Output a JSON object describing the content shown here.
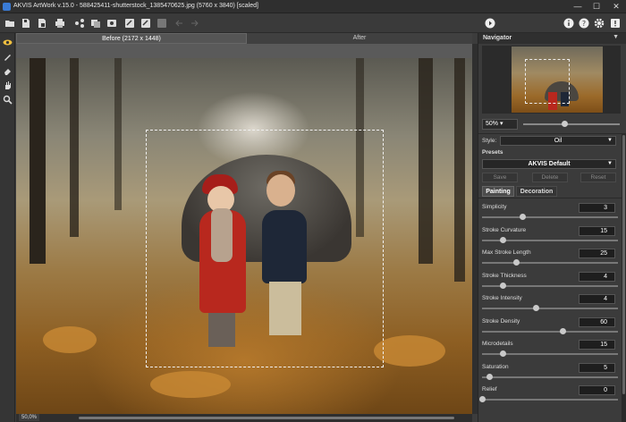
{
  "window": {
    "title": "AKVIS ArtWork v.15.0 - 588425411-shutterstock_1385470625.jpg (5760 x 3840) [scaled]",
    "minimize": "—",
    "maximize": "☐",
    "close": "✕"
  },
  "toolbar": {
    "icons": [
      "open-icon",
      "save-icon",
      "save-as-icon",
      "print-icon",
      "share-icon",
      "batch-icon",
      "preset-icon",
      "settings-icon",
      "undo-icon",
      "redo-icon",
      "forward-icon",
      "back-icon",
      "run-icon",
      "info-icon",
      "help-icon",
      "gear-icon",
      "notification-icon"
    ]
  },
  "left_tools": [
    "eye-icon",
    "brush-icon",
    "eraser-icon",
    "hand-icon",
    "zoom-icon"
  ],
  "view_tabs": {
    "before": "Before (2172 x 1448)",
    "after": "After"
  },
  "status": {
    "zoom": "50,0%"
  },
  "navigator": {
    "header": "Navigator",
    "zoom": "50%",
    "zoom_slider": 0.5
  },
  "settings": {
    "style_label": "Style:",
    "style_value": "Oil",
    "presets_label": "Presets",
    "preset_value": "AKVIS Default",
    "save": "Save",
    "delete": "Delete",
    "reset": "Reset",
    "tab_painting": "Painting",
    "tab_decoration": "Decoration",
    "params": [
      {
        "label": "Simplicity",
        "value": "3",
        "fraction": 0.3
      },
      {
        "label": "Stroke Curvature",
        "value": "15",
        "fraction": 0.15
      },
      {
        "label": "Max Stroke Length",
        "value": "25",
        "fraction": 0.25
      },
      {
        "label": "Stroke Thickness",
        "value": "4",
        "fraction": 0.15
      },
      {
        "label": "Stroke Intensity",
        "value": "4",
        "fraction": 0.4
      },
      {
        "label": "Stroke Density",
        "value": "60",
        "fraction": 0.6
      },
      {
        "label": "Microdetails",
        "value": "15",
        "fraction": 0.15
      },
      {
        "label": "Saturation",
        "value": "5",
        "fraction": 0.05
      },
      {
        "label": "Relief",
        "value": "0",
        "fraction": 0.0
      }
    ]
  },
  "colors": {
    "accent": "#3a7bd5",
    "panel": "#3b3b3b"
  }
}
